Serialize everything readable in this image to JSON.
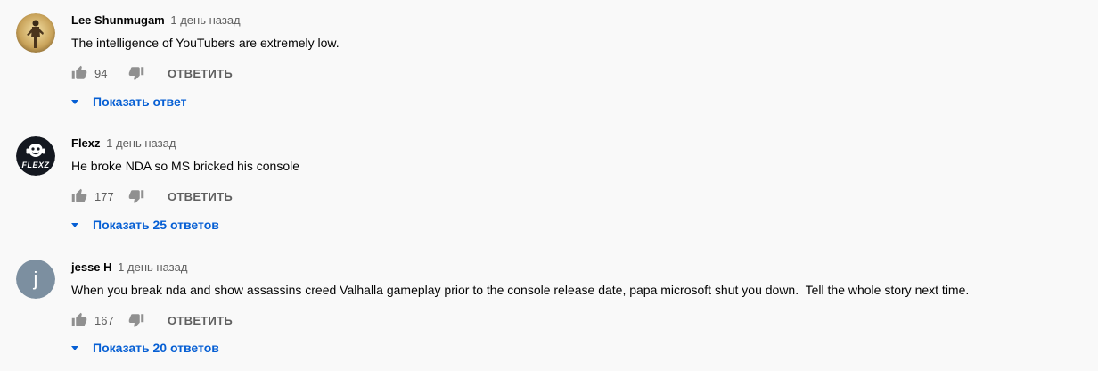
{
  "comments": [
    {
      "author": "Lee Shunmugam",
      "time": "1 день назад",
      "text": "The intelligence of YouTubers are extremely low.",
      "likes": "94",
      "reply_label": "ОТВЕТИТЬ",
      "show_replies": "Показать ответ",
      "avatar_icon": "person-figure-icon"
    },
    {
      "author": "Flexz",
      "time": "1 день назад",
      "text": "He broke NDA so MS bricked his console",
      "likes": "177",
      "reply_label": "ОТВЕТИТЬ",
      "show_replies": "Показать 25 ответов",
      "avatar_icon": "flexz-logo-icon",
      "avatar_logo_text": "FLEXZ"
    },
    {
      "author": "jesse H",
      "time": "1 день назад",
      "text": "When you break nda and show assassins creed Valhalla gameplay prior to the console release date, papa microsoft shut you down.  Tell the whole story next time.",
      "likes": "167",
      "reply_label": "ОТВЕТИТЬ",
      "show_replies": "Показать 20 ответов",
      "avatar_icon": "letter-avatar",
      "avatar_letter": "j"
    }
  ],
  "colors": {
    "background": "#f9f9f9",
    "link_blue": "#065fd4",
    "secondary_text": "#606060",
    "primary_text": "#030303",
    "letter_avatar_bg": "#7c8fa0"
  }
}
